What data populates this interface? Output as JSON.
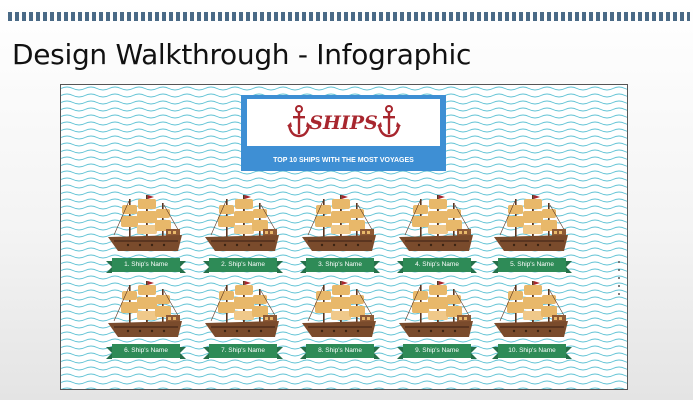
{
  "slide": {
    "title": "Design Walkthrough - Infographic"
  },
  "infographic": {
    "heading": "SHIPS",
    "subheading": "TOP 10 SHIPS WITH THE MOST VOYAGES",
    "ships": [
      {
        "label": "1. Ship's Name"
      },
      {
        "label": "2. Ship's Name"
      },
      {
        "label": "3. Ship's Name"
      },
      {
        "label": "4. Ship's Name"
      },
      {
        "label": "5. Ship's Name"
      },
      {
        "label": "6. Ship's Name"
      },
      {
        "label": "7. Ship's Name"
      },
      {
        "label": "8. Ship's Name"
      },
      {
        "label": "9. Ship's Name"
      },
      {
        "label": "10. Ship's Name"
      }
    ]
  },
  "colors": {
    "accent_blue": "#3e8fd4",
    "anchor_red": "#a8262e",
    "wave": "#5fc2d4",
    "ribbon": "#2e8b57",
    "hull": "#7a4b2c",
    "sail": "#e8b86a"
  },
  "icons": {
    "anchor": "anchor-icon",
    "ship": "ship-icon"
  }
}
